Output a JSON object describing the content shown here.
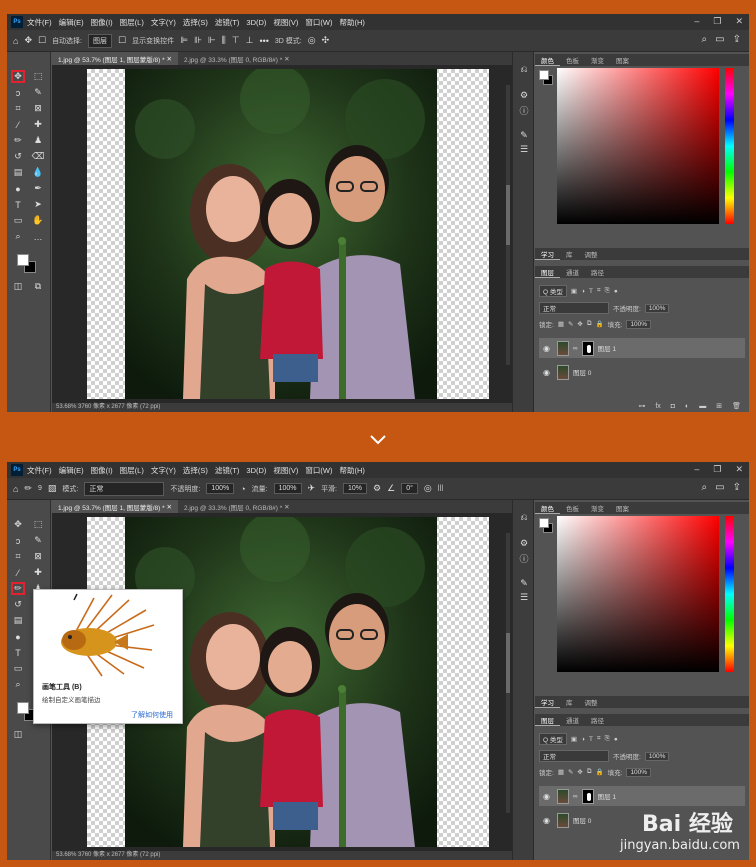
{
  "menu": [
    "文件(F)",
    "编辑(E)",
    "图像(I)",
    "图层(L)",
    "文字(Y)",
    "选择(S)",
    "滤镜(T)",
    "3D(D)",
    "视图(V)",
    "窗口(W)",
    "帮助(H)"
  ],
  "ps_label": "Ps",
  "shot1": {
    "options": {
      "auto_select_label": "自动选择:",
      "auto_select_value": "图层",
      "transform_label": "显示变换控件",
      "mode_3d_label": "3D 模式:"
    },
    "tabs": [
      "1.jpg @ 53.7% (图层 1, 图层蒙版/8) *",
      "2.jpg @ 33.3% (图层 0, RGB/8#) *"
    ],
    "status": "53.68%   3760 像素 x 2677 像素 (72 ppi)"
  },
  "shot2": {
    "options": {
      "brush_size": "9",
      "mode_label": "模式:",
      "mode_value": "正常",
      "opacity_label": "不透明度:",
      "opacity_value": "100%",
      "flow_label": "流量:",
      "flow_value": "100%",
      "smooth_label": "平滑:",
      "smooth_value": "10%",
      "angle_value": "0°"
    },
    "tabs": [
      "1.jpg @ 53.7% (图层 1, 图层蒙版/8) *",
      "2.jpg @ 33.3% (图层 0, RGB/8#) *"
    ],
    "status": "53.68%   3760 像素 x 2677 像素 (72 ppi)",
    "tooltip": {
      "title": "画笔工具 (B)",
      "desc": "绘制自定义画笔描边",
      "link": "了解如何使用"
    }
  },
  "panel": {
    "color_tabs": [
      "颜色",
      "色板",
      "渐变",
      "图案"
    ],
    "learn_tabs": [
      "学习",
      "库",
      "调整"
    ],
    "layer_tabs": [
      "图层",
      "通道",
      "路径"
    ],
    "kind": "Q 类型",
    "blend": "正常",
    "opacity_label": "不透明度:",
    "opacity_value": "100%",
    "lock_label": "锁定:",
    "fill_label": "填充:",
    "fill_value": "100%",
    "layers": [
      "图层 1",
      "图层 0"
    ]
  },
  "watermark": {
    "brand": "Bai 经验",
    "url": "jingyan.baidu.com"
  }
}
